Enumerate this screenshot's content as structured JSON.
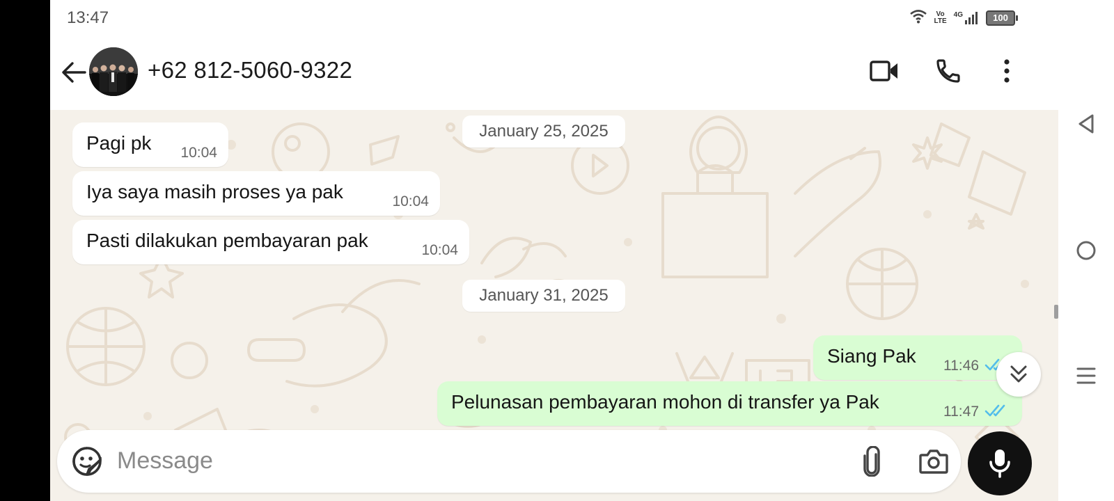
{
  "status_bar": {
    "time": "13:47",
    "volte_top": "Vo",
    "volte_bottom": "LTE",
    "network": "4G",
    "battery": "100"
  },
  "header": {
    "contact_name": "+62 812-5060-9322"
  },
  "chat": {
    "date_dividers": [
      "January 25, 2025",
      "January 31, 2025"
    ],
    "messages": [
      {
        "text": "Pagi pk",
        "time": "10:04",
        "direction": "incoming"
      },
      {
        "text": "Iya saya masih proses ya pak",
        "time": "10:04",
        "direction": "incoming"
      },
      {
        "text": "Pasti dilakukan pembayaran pak",
        "time": "10:04",
        "direction": "incoming"
      },
      {
        "text": "Siang Pak",
        "time": "11:46",
        "direction": "outgoing",
        "status": "read"
      },
      {
        "text": "Pelunasan pembayaran mohon di transfer ya Pak",
        "time": "11:47",
        "direction": "outgoing",
        "status": "read"
      }
    ]
  },
  "input": {
    "placeholder": "Message",
    "value": ""
  },
  "colors": {
    "incoming_bubble": "#ffffff",
    "outgoing_bubble": "#d9fdd3",
    "read_tick": "#53bdeb",
    "chat_background": "#f5f1ea"
  },
  "icons": [
    "back-arrow-icon",
    "video-call-icon",
    "phone-icon",
    "more-options-icon",
    "emoji-sticker-icon",
    "paperclip-icon",
    "camera-icon",
    "microphone-icon",
    "double-chevron-down-icon",
    "read-double-check-icon",
    "nav-back-icon",
    "nav-home-icon",
    "nav-menu-icon"
  ]
}
